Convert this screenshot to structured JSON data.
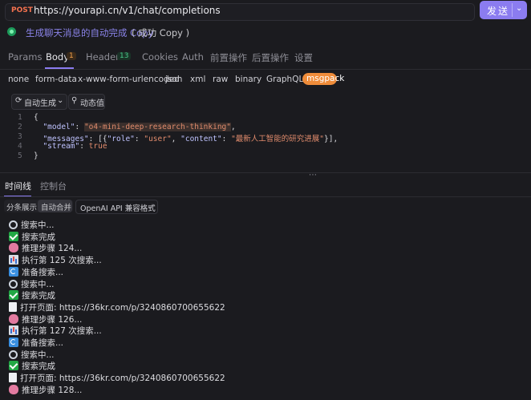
{
  "request": {
    "method": "POST",
    "url": "https://yourapi.cn/v1/chat/completions",
    "send_label": "发送",
    "title": "生成聊天消息的自动完成 Copy",
    "title_status": "( 成功 Copy )"
  },
  "tabs": [
    {
      "label": "Params"
    },
    {
      "label": "Body",
      "badge": "1"
    },
    {
      "label": "Headers",
      "badge": "13"
    },
    {
      "label": "Cookies"
    },
    {
      "label": "Auth"
    },
    {
      "label": "前置操作"
    },
    {
      "label": "后置操作"
    },
    {
      "label": "设置"
    }
  ],
  "body_types": [
    "none",
    "form-data",
    "x-www-form-urlencoded",
    "json",
    "xml",
    "raw",
    "binary",
    "GraphQL",
    "msgpack"
  ],
  "toolbar": {
    "auto_generate": "自动生成",
    "dynamic_value": "动态值"
  },
  "code": {
    "line_numbers": [
      "1",
      "2",
      "3",
      "4",
      "5"
    ],
    "open_brace": "{",
    "model_key": "\"model\"",
    "model_value": "\"o4-mini-deep-research-thinking\"",
    "messages_key": "\"messages\"",
    "messages_open": "[{",
    "role_key": "\"role\"",
    "role_value": "\"user\"",
    "content_key": "\"content\"",
    "content_value": "\"最新人工智能的研究进展\"",
    "messages_close": "}],",
    "stream_key": "\"stream\"",
    "stream_value": "true",
    "close_brace": "}"
  },
  "bottom_tabs": {
    "timeline": "时间线",
    "console": "控制台"
  },
  "view_modes": {
    "split": "分条展示",
    "merge": "自动合并",
    "format": "OpenAI API 兼容格式"
  },
  "log": [
    {
      "icon": "search",
      "text": "搜索中..."
    },
    {
      "icon": "check",
      "text": "搜索完成"
    },
    {
      "icon": "brain",
      "text": "推理步骤 124..."
    },
    {
      "icon": "chart",
      "text": "执行第 125 次搜索..."
    },
    {
      "icon": "refresh",
      "text": "准备搜索..."
    },
    {
      "icon": "search",
      "text": "搜索中..."
    },
    {
      "icon": "check",
      "text": "搜索完成"
    },
    {
      "icon": "page",
      "text": "打开页面: https://36kr.com/p/3240860700655622"
    },
    {
      "icon": "brain",
      "text": "推理步骤 126..."
    },
    {
      "icon": "chart",
      "text": "执行第 127 次搜索..."
    },
    {
      "icon": "refresh",
      "text": "准备搜索..."
    },
    {
      "icon": "search",
      "text": "搜索中..."
    },
    {
      "icon": "check",
      "text": "搜索完成"
    },
    {
      "icon": "page",
      "text": "打开页面: https://36kr.com/p/3240860700655622"
    },
    {
      "icon": "brain",
      "text": "推理步骤 128..."
    }
  ],
  "colors": {
    "accent": "#8b7cf0",
    "method": "#f3714e",
    "msgpack": "#ef8c3a"
  }
}
